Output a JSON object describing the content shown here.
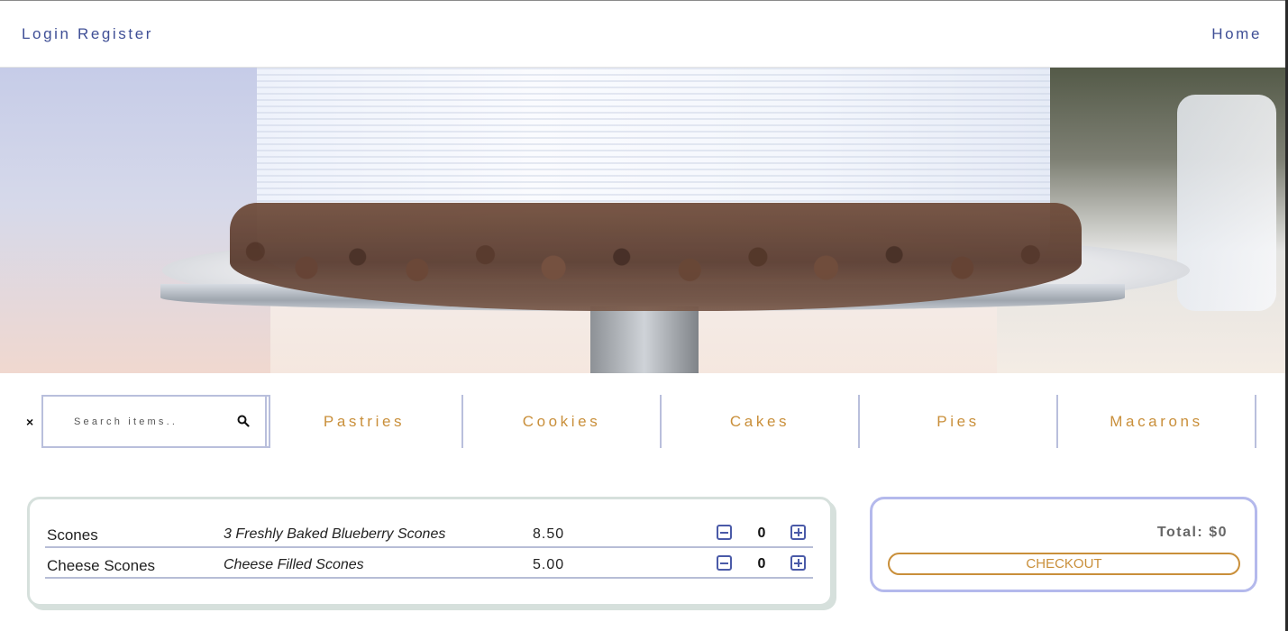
{
  "header": {
    "login_label": "Login",
    "register_label": "Register",
    "home_label": "Home"
  },
  "hero": {
    "image_subject": "frosted cake with chocolate shavings on glass cake stand"
  },
  "search": {
    "clear_label": "×",
    "placeholder": "Search items..",
    "icon": "search-icon"
  },
  "categories": [
    "Pastries",
    "Cookies",
    "Cakes",
    "Pies",
    "Macarons"
  ],
  "items": [
    {
      "name": "Scones",
      "description": "3 Freshly Baked Blueberry Scones",
      "price": "8.50",
      "quantity": "0"
    },
    {
      "name": "Cheese Scones",
      "description": "Cheese Filled Scones",
      "price": "5.00",
      "quantity": "0"
    }
  ],
  "cart": {
    "total_label": "Total: $0",
    "checkout_label": "CHECKOUT"
  },
  "colors": {
    "nav_text": "#3f4f96",
    "accent_gold": "#c98f3a",
    "divider_lavender": "#b9bfdc",
    "items_border": "#d6e0dc",
    "cart_border": "#b4b9ec"
  }
}
